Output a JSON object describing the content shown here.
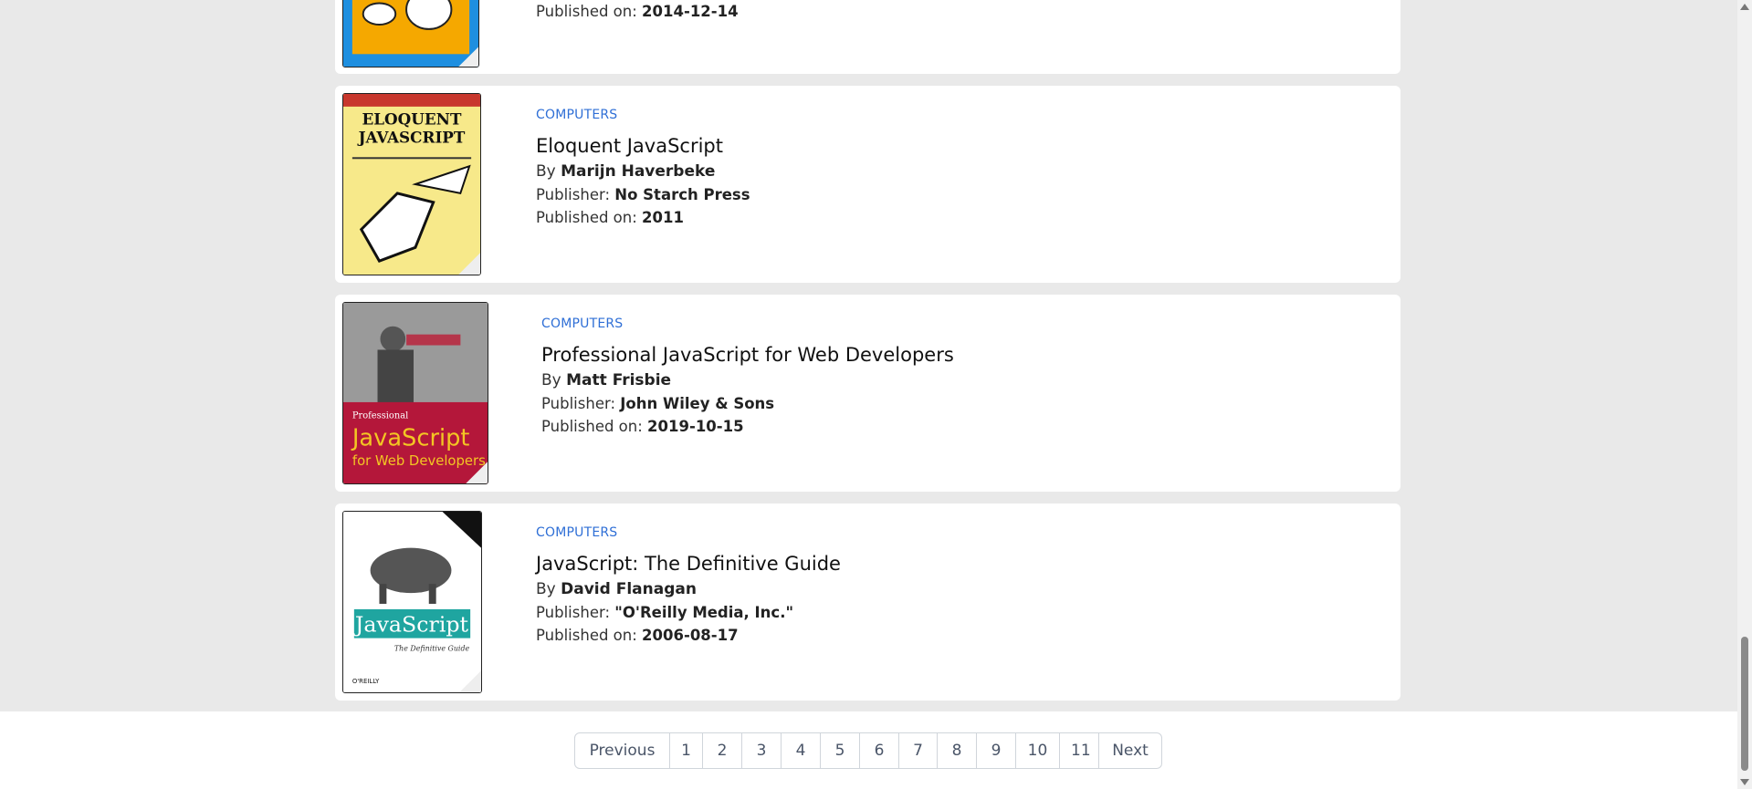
{
  "books": [
    {
      "category": "",
      "title": "",
      "author": "",
      "publisher": "",
      "published": "2014-12-14"
    },
    {
      "category": "COMPUTERS",
      "title": "Eloquent JavaScript",
      "author": "Marijn Haverbeke",
      "publisher": "No Starch Press",
      "published": "2011",
      "cover_text": [
        "ELOQUENT",
        "JAVASCRIPT"
      ]
    },
    {
      "category": "COMPUTERS",
      "title": "Professional JavaScript for Web Developers",
      "author": "Matt Frisbie",
      "publisher": "John Wiley & Sons",
      "published": "2019-10-15",
      "cover_text": [
        "Professional",
        "JavaScript",
        "for Web Developers"
      ]
    },
    {
      "category": "COMPUTERS",
      "title": "JavaScript: The Definitive Guide",
      "author": "David Flanagan",
      "publisher": "\"O'Reilly Media, Inc.\"",
      "published": "2006-08-17",
      "cover_text": [
        "JavaScript",
        "The Definitive Guide",
        "O'REILLY"
      ]
    }
  ],
  "labels": {
    "by": "By",
    "publisher": "Publisher:",
    "published_on": "Published on:"
  },
  "pagination": {
    "previous": "Previous",
    "pages": [
      "1",
      "2",
      "3",
      "4",
      "5",
      "6",
      "7",
      "8",
      "9",
      "10",
      "11"
    ],
    "next": "Next"
  },
  "colors": {
    "category": "#2f6fd6",
    "background": "#e9e9e9",
    "card": "#ffffff"
  }
}
